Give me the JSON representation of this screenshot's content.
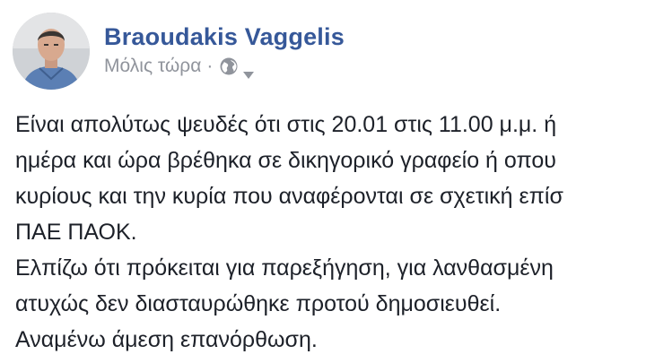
{
  "post": {
    "author": "Braoudakis Vaggelis",
    "timestamp": "Μόλις τώρα",
    "separator": "·",
    "privacy_icon": "globe-icon",
    "menu_icon": "chevron-down-icon",
    "lines": [
      "Είναι απολύτως ψευδές ότι στις 20.01 στις 11.00 μ.μ. ή",
      "ημέρα και ώρα βρέθηκα σε δικηγορικό γραφείο ή οπου",
      "κυρίους και την κυρία που αναφέρονται σε σχετική επίσ",
      "ΠΑΕ ΠΑΟΚ.",
      "Ελπίζω ότι πρόκειται για παρεξήγηση, για λανθασμένη",
      "ατυχώς δεν διασταυρώθηκε προτού δημοσιευθεί.",
      "Αναμένω άμεση επανόρθωση."
    ]
  },
  "colors": {
    "author": "#365899",
    "meta": "#90949c",
    "text": "#1d2129"
  }
}
